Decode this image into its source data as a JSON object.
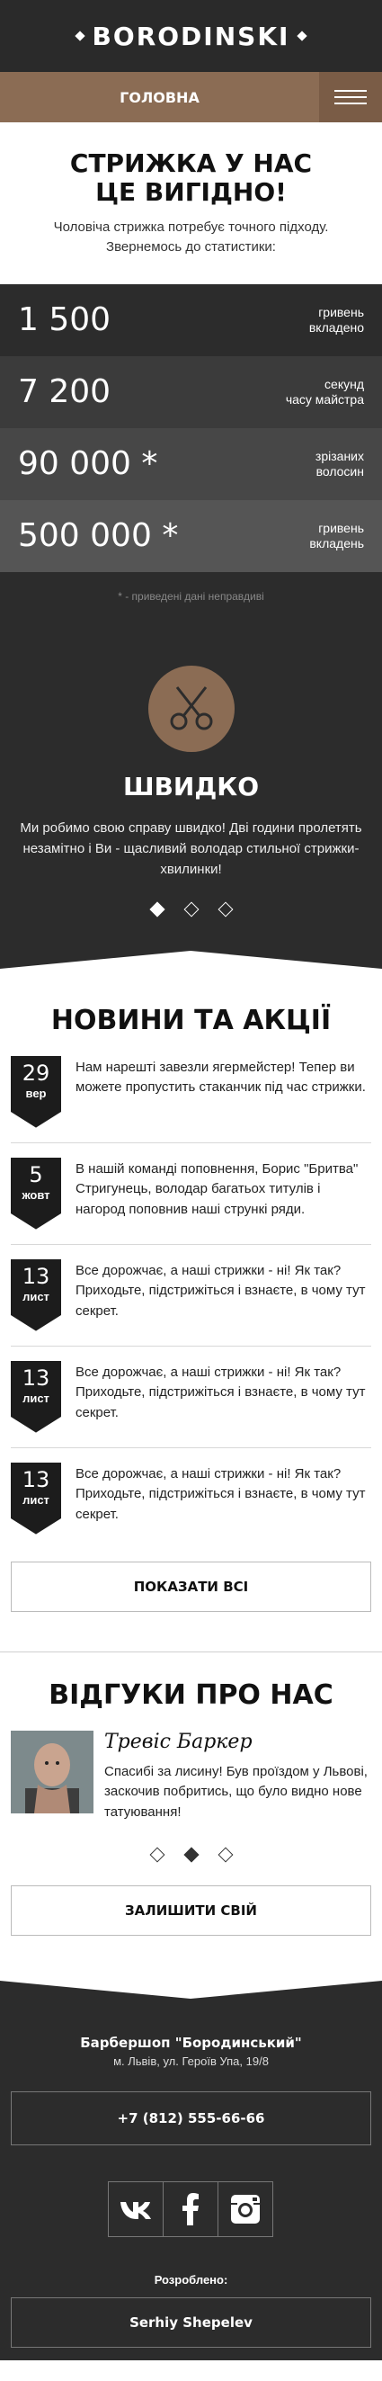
{
  "header": {
    "logo": "BORODINSKI"
  },
  "nav": {
    "home_label": "ГОЛОВНА"
  },
  "intro": {
    "title_line1": "СТРИЖКА У НАС",
    "title_line2": "ЦЕ ВИГІДНО!",
    "text": "Чоловіча стрижка потребує точного підходу. Звернемось до статистики:"
  },
  "stats": {
    "items": [
      {
        "value": "1 500",
        "label_line1": "гривень",
        "label_line2": "вкладено"
      },
      {
        "value": "7 200",
        "label_line1": "секунд",
        "label_line2": "часу майстра"
      },
      {
        "value": "90 000 *",
        "label_line1": "зрізаних",
        "label_line2": "волосин"
      },
      {
        "value": "500 000 *",
        "label_line1": "гривень",
        "label_line2": "вкладень"
      }
    ],
    "note": "* - приведені дані неправдиві"
  },
  "slider": {
    "icon": "scissors-icon",
    "title": "ШВИДКО",
    "text": "Ми робимо свою справу швидко! Дві години пролетять незамітно і Ви - щасливий володар стильної стрижки-хвилинки!",
    "active_slide": 1,
    "slide_count": 3
  },
  "news": {
    "title": "НОВИНИ ТА АКЦІЇ",
    "items": [
      {
        "day": "29",
        "month": "вер",
        "text": "Нам нарешті завезли ягермейстер! Тепер ви можете пропустить стаканчик під час стрижки."
      },
      {
        "day": "5",
        "month": "жовт",
        "text": "В нашій команді поповнення, Борис \"Бритва\" Стригунець, володар багатьох титулів і нагород поповнив наші стрункі ряди."
      },
      {
        "day": "13",
        "month": "лист",
        "text": "Все дорожчає, а наші стрижки - ні! Як так? Приходьте, підстрижіться і взнаєте, в чому тут секрет."
      },
      {
        "day": "13",
        "month": "лист",
        "text": "Все дорожчає, а наші стрижки - ні! Як так? Приходьте, підстрижіться і взнаєте, в чому тут секрет."
      },
      {
        "day": "13",
        "month": "лист",
        "text": "Все дорожчає, а наші стрижки - ні! Як так? Приходьте, підстрижіться і взнаєте, в чому тут секрет."
      }
    ],
    "show_all_label": "ПОКАЗАТИ ВСІ"
  },
  "reviews": {
    "title": "ВІДГУКИ ПРО НАС",
    "name": "Тревіс Баркер",
    "text": "Спасибі за лисину! Був проїздом у Львові, заскочив побритись, що було видно нове татуювання!",
    "active_slide": 2,
    "slide_count": 3,
    "leave_label": "ЗАЛИШИТИ СВІЙ"
  },
  "footer": {
    "name": "Барбершоп \"Бородинський\"",
    "address": "м. Львів, ул. Героїв Упа, 19/8",
    "phone": "+7 (812) 555-66-66",
    "socials": [
      "vk-icon",
      "facebook-icon",
      "instagram-icon"
    ],
    "dev_label": "Розроблено:",
    "dev_name": "Serhiy Shepelev"
  },
  "colors": {
    "dark": "#2c2c2c",
    "accent": "#8b6c54"
  }
}
